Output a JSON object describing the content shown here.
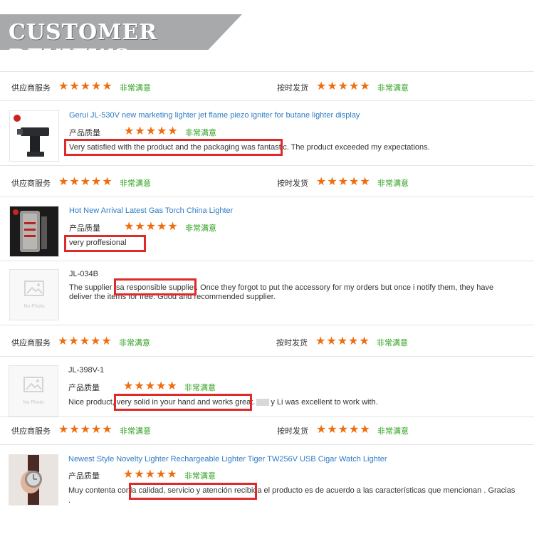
{
  "header": {
    "title": "CUSTOMER REVIEWS"
  },
  "labels": {
    "supplier_service": "供应商服务",
    "ontime_shipping": "按时发货",
    "product_quality": "产品质量",
    "very_satisfied": "非常满意",
    "no_photo": "No Photo"
  },
  "colors": {
    "star": "#ef6d0f",
    "satisfied": "#2fa21f",
    "link": "#2f7cc4",
    "highlight": "#e02a2a",
    "banner": "#a7a9ab"
  },
  "rating_rows": [
    {
      "supplier_rating": 5,
      "shipping_rating": 5
    },
    {
      "supplier_rating": 5,
      "shipping_rating": 5
    },
    {
      "supplier_rating": 5,
      "shipping_rating": 5
    },
    {
      "supplier_rating": 5,
      "shipping_rating": 5
    }
  ],
  "reviews": [
    {
      "title": "Gerui JL-530V new marketing lighter jet flame piezo igniter for butane lighter display",
      "rating": 5,
      "text_highlight": "Very satisfied with the product and the packaging was fantastic.",
      "text_rest": " The product exceeded my expectations.",
      "thumb_icon": "torch-lighter-photo"
    },
    {
      "title": "Hot New Arrival Latest Gas Torch China Lighter",
      "rating": 5,
      "text_highlight": "very proffesional",
      "thumb_icon": "gas-torch-lighter-photo"
    },
    {
      "title": "JL-034B",
      "text_pre": "The supplier is",
      "text_highlight": "a responsible supplier",
      "text_rest": ". Once they forgot to put the accessory for my orders but once i notify them, they have deliver the items for free.   Good and recommended supplier.",
      "thumb_icon": "no-photo-icon"
    },
    {
      "title": "JL-398V-1",
      "rating": 5,
      "text_pre": "Nice product, v",
      "text_highlight": "ery solid in your hand and works great.",
      "text_rest": "y Li was excellent to work with.",
      "thumb_icon": "no-photo-icon"
    },
    {
      "title": "Newest Style Novelty Lighter Rechargeable Lighter Tiger TW256V USB Cigar Watch Lighter",
      "rating": 5,
      "text_pre": "Muy contenta con",
      "text_highlight": "la calidad, servicio y atención recibida",
      "text_rest": " el producto es de acuerdo a las características que mencionan . Gracias",
      "text_line2": ".",
      "thumb_icon": "watch-lighter-photo"
    }
  ]
}
